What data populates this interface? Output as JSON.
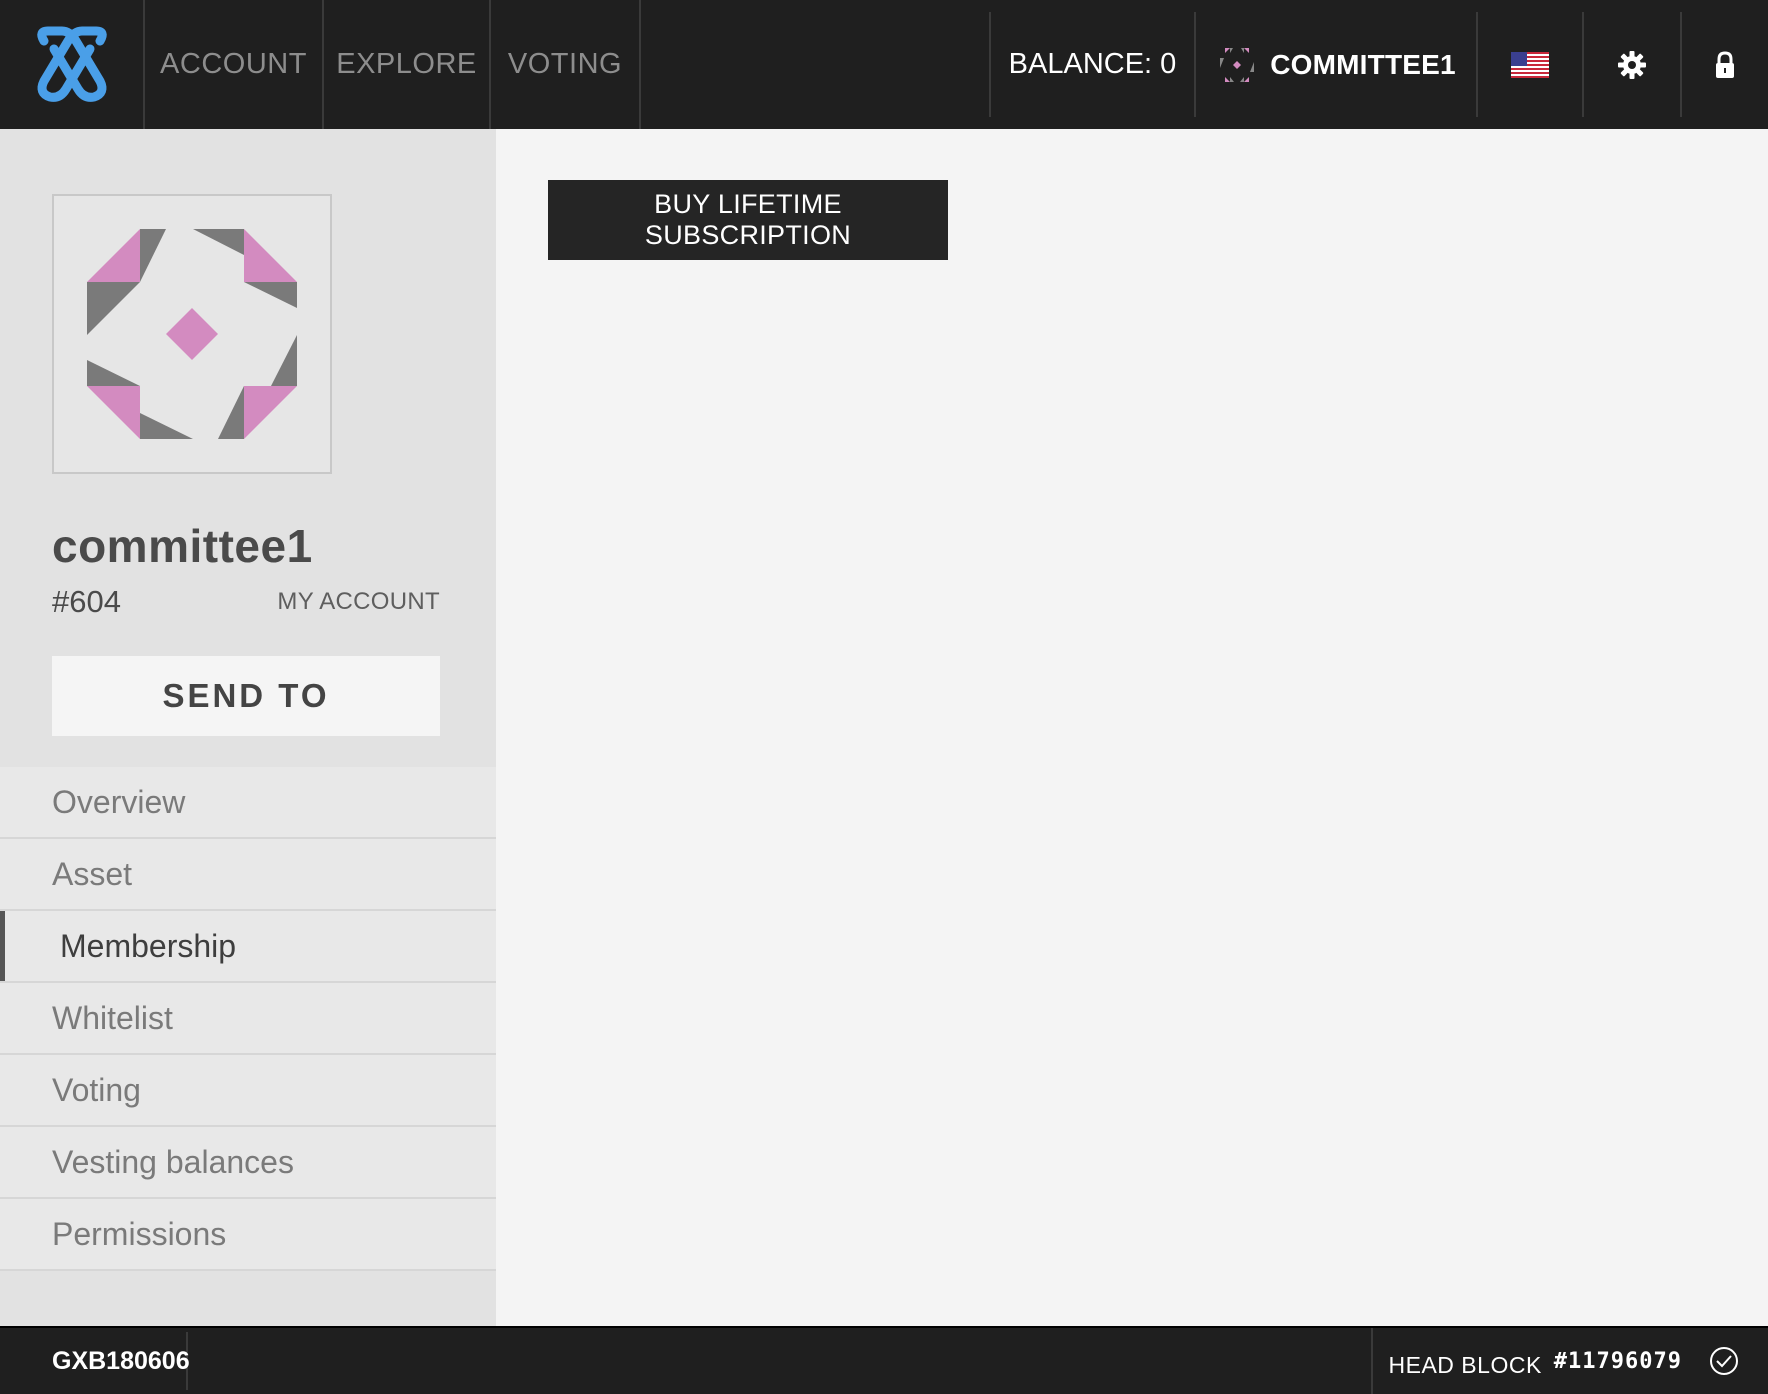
{
  "topbar": {
    "nav": {
      "account": "ACCOUNT",
      "explore": "EXPLORE",
      "voting": "VOTING"
    },
    "balance": "BALANCE: 0",
    "account_name": "COMMITTEE1",
    "icons": {
      "logo": "gxchain-logo",
      "language": "us-flag-icon",
      "settings": "gear-icon",
      "lock": "lock-icon"
    }
  },
  "sidebar": {
    "account_name": "committee1",
    "account_id": "#604",
    "my_account_label": "MY ACCOUNT",
    "send_to_label": "SEND TO",
    "menu": [
      {
        "label": "Overview",
        "active": false
      },
      {
        "label": "Asset",
        "active": false
      },
      {
        "label": "Membership",
        "active": true
      },
      {
        "label": "Whitelist",
        "active": false
      },
      {
        "label": "Voting",
        "active": false
      },
      {
        "label": "Vesting balances",
        "active": false
      },
      {
        "label": "Permissions",
        "active": false
      }
    ]
  },
  "main": {
    "buy_button_label": "BUY LIFETIME SUBSCRIPTION"
  },
  "footer": {
    "version": "GXB180606",
    "head_block_label": "HEAD BLOCK",
    "head_block_number": "#11796079"
  },
  "colors": {
    "topbar_bg": "#1f1f1f",
    "logo_blue": "#4a9fe8",
    "avatar_pink": "#d38bc0",
    "avatar_gray": "#7a7a7a"
  }
}
